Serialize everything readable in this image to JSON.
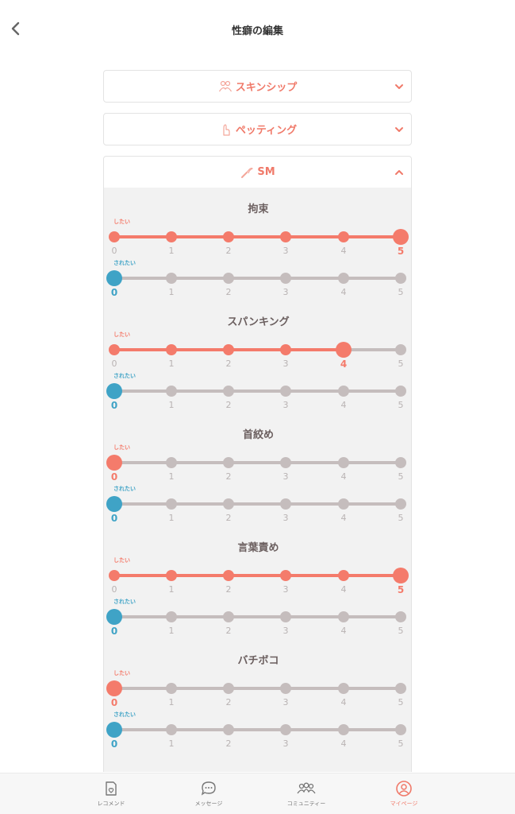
{
  "header": {
    "title": "性癖の編集"
  },
  "accordions": [
    {
      "label": "スキンシップ",
      "icon": "people-icon",
      "expanded": false
    },
    {
      "label": "ペッティング",
      "icon": "hand-icon",
      "expanded": false
    },
    {
      "label": "SM",
      "icon": "whip-icon",
      "expanded": true
    }
  ],
  "sm": {
    "categories": [
      {
        "title": "拘束",
        "want": {
          "label": "したい",
          "value": 5
        },
        "receive": {
          "label": "されたい",
          "value": 0
        }
      },
      {
        "title": "スパンキング",
        "want": {
          "label": "したい",
          "value": 4
        },
        "receive": {
          "label": "されたい",
          "value": 0
        }
      },
      {
        "title": "首絞め",
        "want": {
          "label": "したい",
          "value": 0
        },
        "receive": {
          "label": "されたい",
          "value": 0
        }
      },
      {
        "title": "言葉責め",
        "want": {
          "label": "したい",
          "value": 5
        },
        "receive": {
          "label": "されたい",
          "value": 0
        }
      },
      {
        "title": "バチボコ",
        "want": {
          "label": "したい",
          "value": 0
        },
        "receive": {
          "label": "されたい",
          "value": 0
        }
      }
    ],
    "ticks": [
      "0",
      "1",
      "2",
      "3",
      "4",
      "5"
    ]
  },
  "colors": {
    "want": "#f47b6b",
    "receive": "#3fa3c6",
    "inactive": "#c5bdbd",
    "accent": "#f07a6a"
  },
  "nav": [
    {
      "label": "レコメンド",
      "icon": "recommend-icon",
      "active": false
    },
    {
      "label": "メッセージ",
      "icon": "message-icon",
      "active": false
    },
    {
      "label": "コミュニティー",
      "icon": "community-icon",
      "active": false
    },
    {
      "label": "マイページ",
      "icon": "profile-icon",
      "active": true
    }
  ]
}
